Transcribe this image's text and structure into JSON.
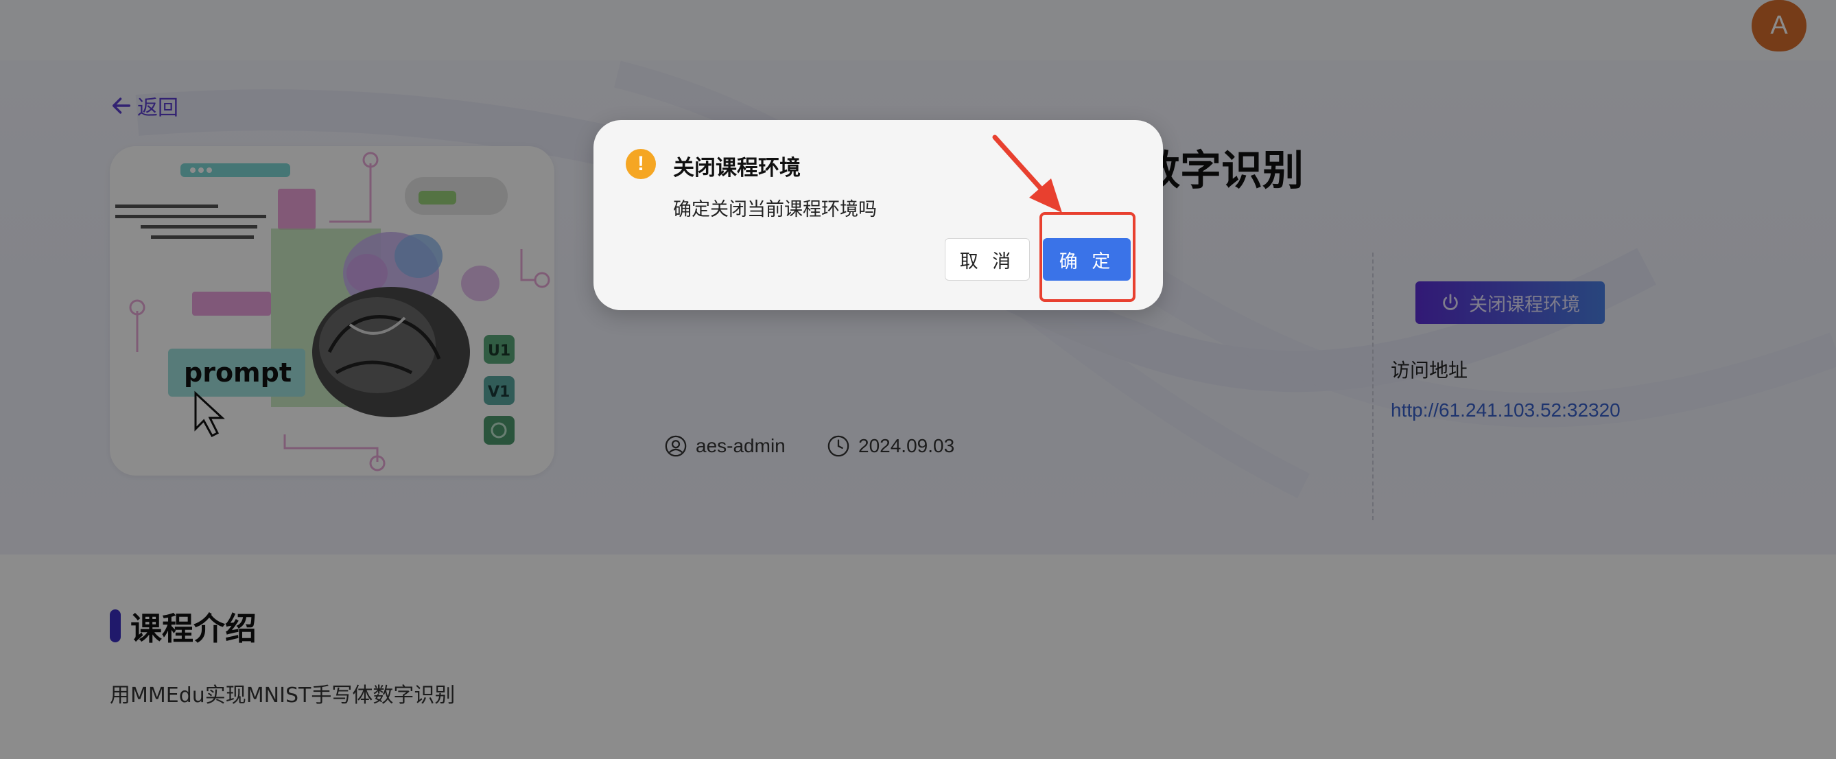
{
  "header": {
    "avatar_letter": "A"
  },
  "hero": {
    "back_label": "返回",
    "cover_prompt_text": "prompt",
    "cover_badges": [
      "U1",
      "V1"
    ],
    "title_visible_tail": "数字识别",
    "author": "aes-admin",
    "date": "2024.09.03",
    "close_env_button": "关闭课程环境",
    "access_label": "访问地址",
    "access_url": "http://61.241.103.52:32320"
  },
  "intro": {
    "heading": "课程介绍",
    "text": "用MMEdu实现MNIST手写体数字识别"
  },
  "dialog": {
    "title": "关闭课程环境",
    "message": "确定关闭当前课程环境吗",
    "cancel_label": "取 消",
    "ok_label": "确 定",
    "warning_symbol": "!"
  },
  "colors": {
    "accent": "#5b2fd6",
    "primary_button": "#3a73e8",
    "warning": "#f5a623",
    "annotation": "#e8402f"
  }
}
